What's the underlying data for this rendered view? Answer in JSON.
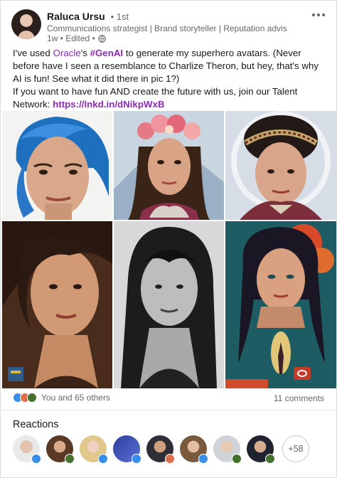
{
  "author": {
    "name": "Raluca Ursu",
    "degree": "• 1st",
    "headline": "Communications strategist | Brand storyteller | Reputation advisor | Peopl...",
    "meta": "1w • Edited •"
  },
  "post": {
    "t1": "I've used ",
    "oracle": "Oracle",
    "t2": "'s ",
    "hashtag": "#GenAI",
    "t3": " to generate my superhero avatars. (Never before have I seen a resemblance to Charlize Theron, but hey, that's why AI is fun! See what it did there in pic 1?)",
    "t4": "If you want to have fun AND create the future with us, join our Talent Network: ",
    "link": "https://lnkd.in/dNikpWxB"
  },
  "social": {
    "reactions_text": "You and 65 others",
    "comments_text": "11 comments"
  },
  "reactions_section": {
    "title": "Reactions",
    "more_count": "+58"
  },
  "colors": {
    "accent": "#8a2bb0",
    "like": "#378fe9",
    "celebrate": "#44712e",
    "love": "#df704d"
  },
  "icons": [
    "more-icon",
    "globe-icon",
    "like-icon",
    "celebrate-icon",
    "love-icon"
  ]
}
